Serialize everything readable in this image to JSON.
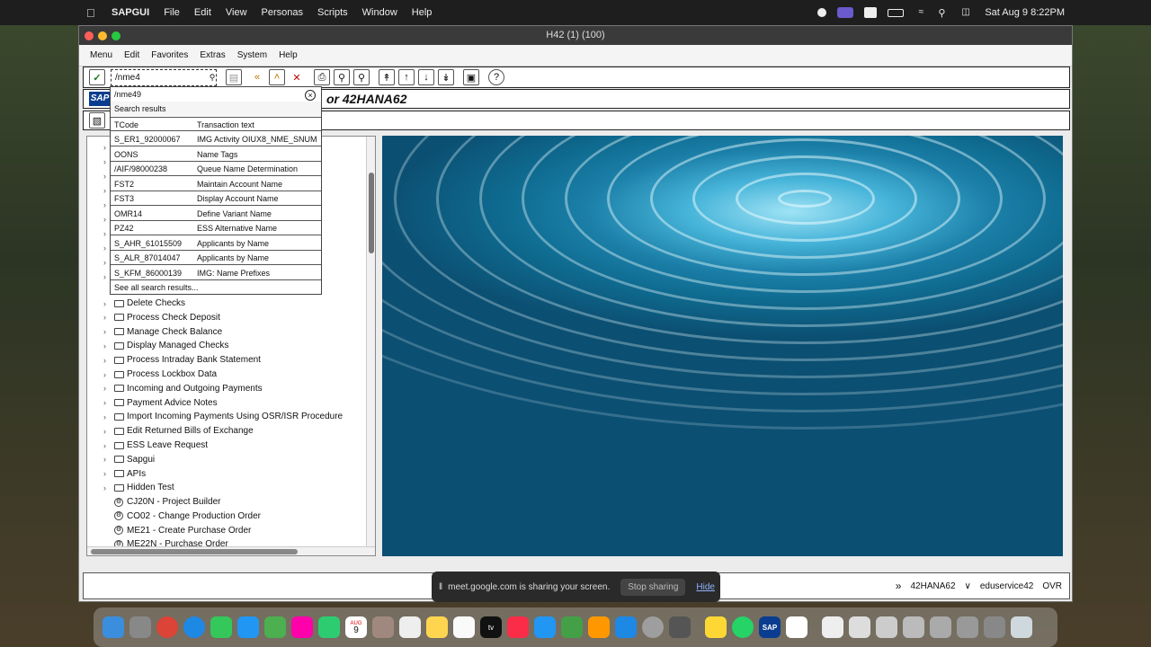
{
  "macbar": {
    "app": "SAPGUI",
    "menus": [
      "File",
      "Edit",
      "View",
      "Personas",
      "Scripts",
      "Window",
      "Help"
    ],
    "datetime": "Sat Aug 9  8:22PM"
  },
  "window": {
    "title": "H42 (1) (100)",
    "menus": [
      "Menu",
      "Edit",
      "Favorites",
      "Extras",
      "System",
      "Help"
    ]
  },
  "toolbar": {
    "command_value": "/nme4"
  },
  "title_row": {
    "logo": "SAP",
    "screen_title": "or 42HANA62"
  },
  "dropdown": {
    "history_item": "/nme49",
    "section_label": "Search results",
    "header": {
      "col1": "TCode",
      "col2": "Transaction text"
    },
    "rows": [
      {
        "tcode": "S_ER1_92000067",
        "text": "IMG Activity OIUX8_NME_SNUM"
      },
      {
        "tcode": "OONS",
        "text": "Name Tags"
      },
      {
        "tcode": "/AIF/98000238",
        "text": "Queue Name Determination"
      },
      {
        "tcode": "FST2",
        "text": "Maintain Account Name"
      },
      {
        "tcode": "FST3",
        "text": "Display Account Name"
      },
      {
        "tcode": "OMR14",
        "text": "Define Variant Name"
      },
      {
        "tcode": "PZ42",
        "text": "ESS Alternative Name"
      },
      {
        "tcode": "S_AHR_61015509",
        "text": "Applicants by Name"
      },
      {
        "tcode": "S_ALR_87014047",
        "text": "Applicants by Name"
      },
      {
        "tcode": "S_KFM_86000139",
        "text": "IMG: Name Prefixes"
      }
    ],
    "see_all": "See all search results..."
  },
  "tree": {
    "folders": [
      "Delete Checks",
      "Process Check Deposit",
      "Manage Check Balance",
      "Display Managed Checks",
      "Process Intraday Bank Statement",
      "Process Lockbox Data",
      "Incoming and Outgoing Payments",
      "Payment Advice Notes",
      "Import Incoming Payments Using OSR/ISR Procedure",
      "Edit Returned Bills of Exchange",
      "ESS Leave Request",
      "Sapgui",
      "APIs",
      "Hidden Test"
    ],
    "transactions": [
      "CJ20N - Project Builder",
      "CO02 - Change Production Order",
      "ME21 - Create Purchase Order",
      "ME22N - Purchase Order"
    ]
  },
  "statusbar": {
    "system": "42HANA62",
    "server": "eduservice42",
    "mode": "OVR"
  },
  "share_banner": {
    "message": "meet.google.com is sharing your screen.",
    "stop": "Stop sharing",
    "hide": "Hide"
  },
  "dock": {
    "calendar_month": "AUG",
    "calendar_day": "9",
    "tv_label": "tv"
  }
}
